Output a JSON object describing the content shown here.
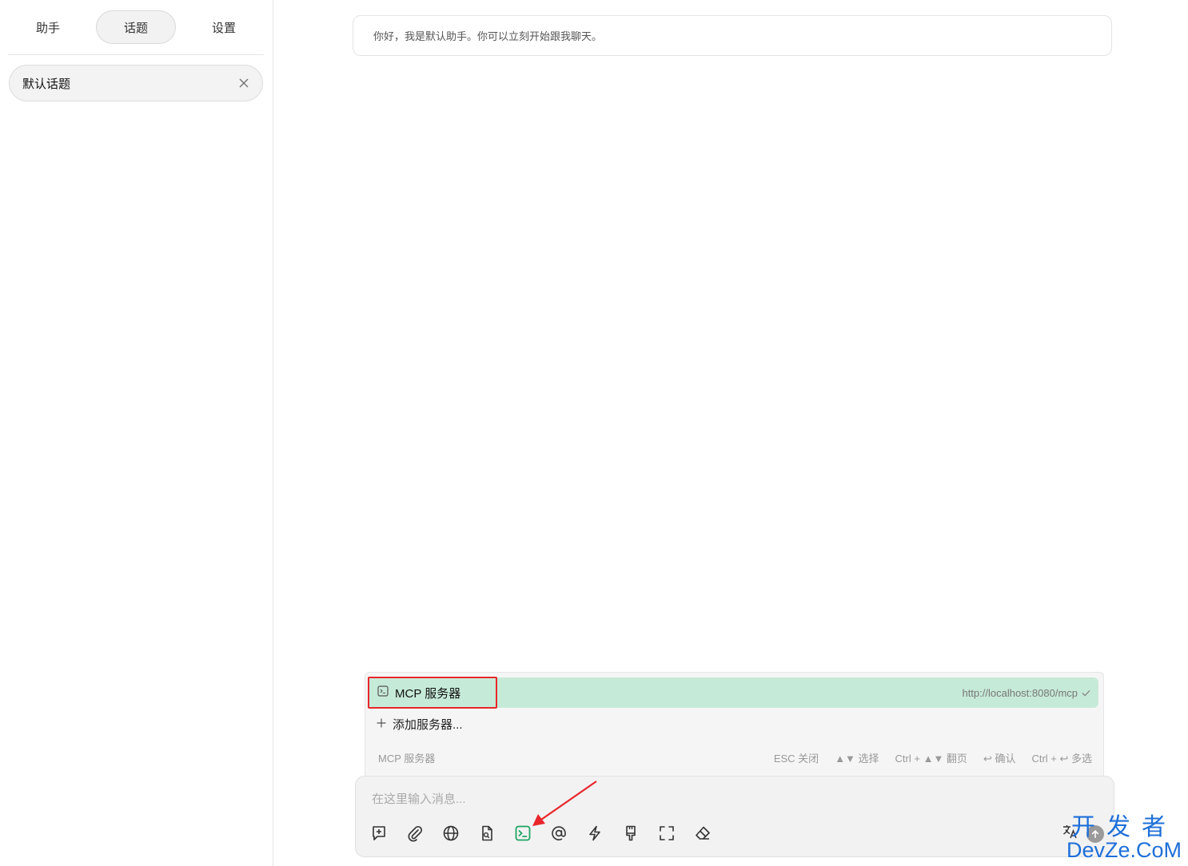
{
  "sidebar": {
    "tabs": [
      {
        "label": "助手",
        "active": false
      },
      {
        "label": "话题",
        "active": true
      },
      {
        "label": "设置",
        "active": false
      }
    ],
    "topics": [
      {
        "title": "默认话题"
      }
    ]
  },
  "chat": {
    "greeting": "你好，我是默认助手。你可以立刻开始跟我聊天。"
  },
  "mcp_popup": {
    "items": [
      {
        "label": "MCP 服务器",
        "url": "http://localhost:8080/mcp",
        "selected": true
      }
    ],
    "add_label": "添加服务器...",
    "footer_title": "MCP 服务器",
    "hints": [
      "ESC 关闭",
      "▲▼ 选择",
      "Ctrl + ▲▼ 翻页",
      "↩ 确认",
      "Ctrl + ↩ 多选"
    ]
  },
  "input": {
    "placeholder": "在这里输入消息..."
  },
  "toolbar": {
    "icons": [
      "new-topic-icon",
      "attachment-icon",
      "web-search-icon",
      "knowledge-file-icon",
      "mcp-terminal-icon",
      "mention-icon",
      "quick-phrase-icon",
      "clear-brush-icon",
      "fullscreen-icon",
      "eraser-icon"
    ],
    "active_icon": "mcp-terminal-icon",
    "active_color": "#1fa463"
  },
  "watermark": {
    "line1": "开发者",
    "line2": "DevZe.CoM"
  },
  "colors": {
    "selected_item_bg": "#c6ead8",
    "highlight_box": "#e8262b",
    "watermark": "#1e6fd9"
  }
}
